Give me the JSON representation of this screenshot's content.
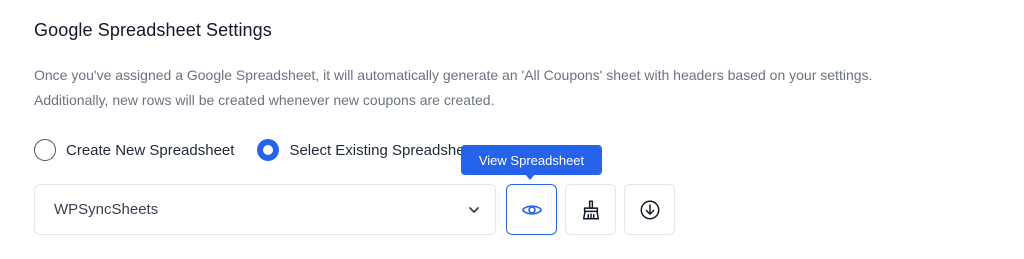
{
  "section": {
    "title": "Google Spreadsheet Settings",
    "description_line1": "Once you've assigned a Google Spreadsheet, it will automatically generate an 'All Coupons' sheet with headers based on your settings.",
    "description_line2": "Additionally, new rows will be created whenever new coupons are created."
  },
  "radio_options": [
    {
      "label": "Create New Spreadsheet",
      "checked": false
    },
    {
      "label": "Select Existing Spreadsheet",
      "checked": true
    }
  ],
  "spreadsheet_select": {
    "selected": "WPSyncSheets",
    "icon": "chevron-down-icon"
  },
  "actions": [
    {
      "name": "view-spreadsheet",
      "icon": "eye-icon",
      "active": true
    },
    {
      "name": "clear-spreadsheet",
      "icon": "broom-icon",
      "active": false
    },
    {
      "name": "download-spreadsheet",
      "icon": "download-icon",
      "active": false
    }
  ],
  "tooltip": {
    "text": "View Spreadsheet"
  },
  "colors": {
    "accent": "#2563eb",
    "text": "#1f2937",
    "muted": "#6b7280",
    "border": "#e5e7eb"
  }
}
